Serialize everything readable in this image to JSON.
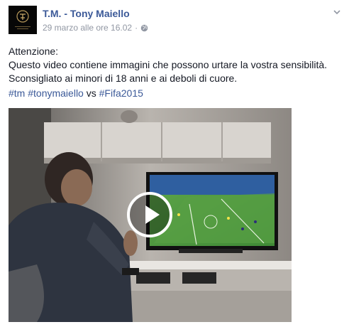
{
  "post": {
    "author": "T.M. - Tony Maiello",
    "date": "29 marzo alle ore 16.02",
    "separator": "·",
    "privacy_icon": "globe-icon",
    "menu_icon": "chevron-down-icon",
    "text_lines": [
      "Attenzione:",
      "Questo video contiene immagini che possono urtare la vostra sensibilità.",
      "Sconsigliato ai minori di 18 anni e ai deboli di cuore."
    ],
    "hashtags": {
      "tag1": "#tm",
      "tag2": "#tonymaiello",
      "connector": "vs",
      "tag3": "#Fifa2015"
    }
  },
  "video": {
    "play_icon": "play-icon"
  },
  "colors": {
    "link": "#3b5998",
    "meta": "#9197a3",
    "text": "#141823"
  }
}
